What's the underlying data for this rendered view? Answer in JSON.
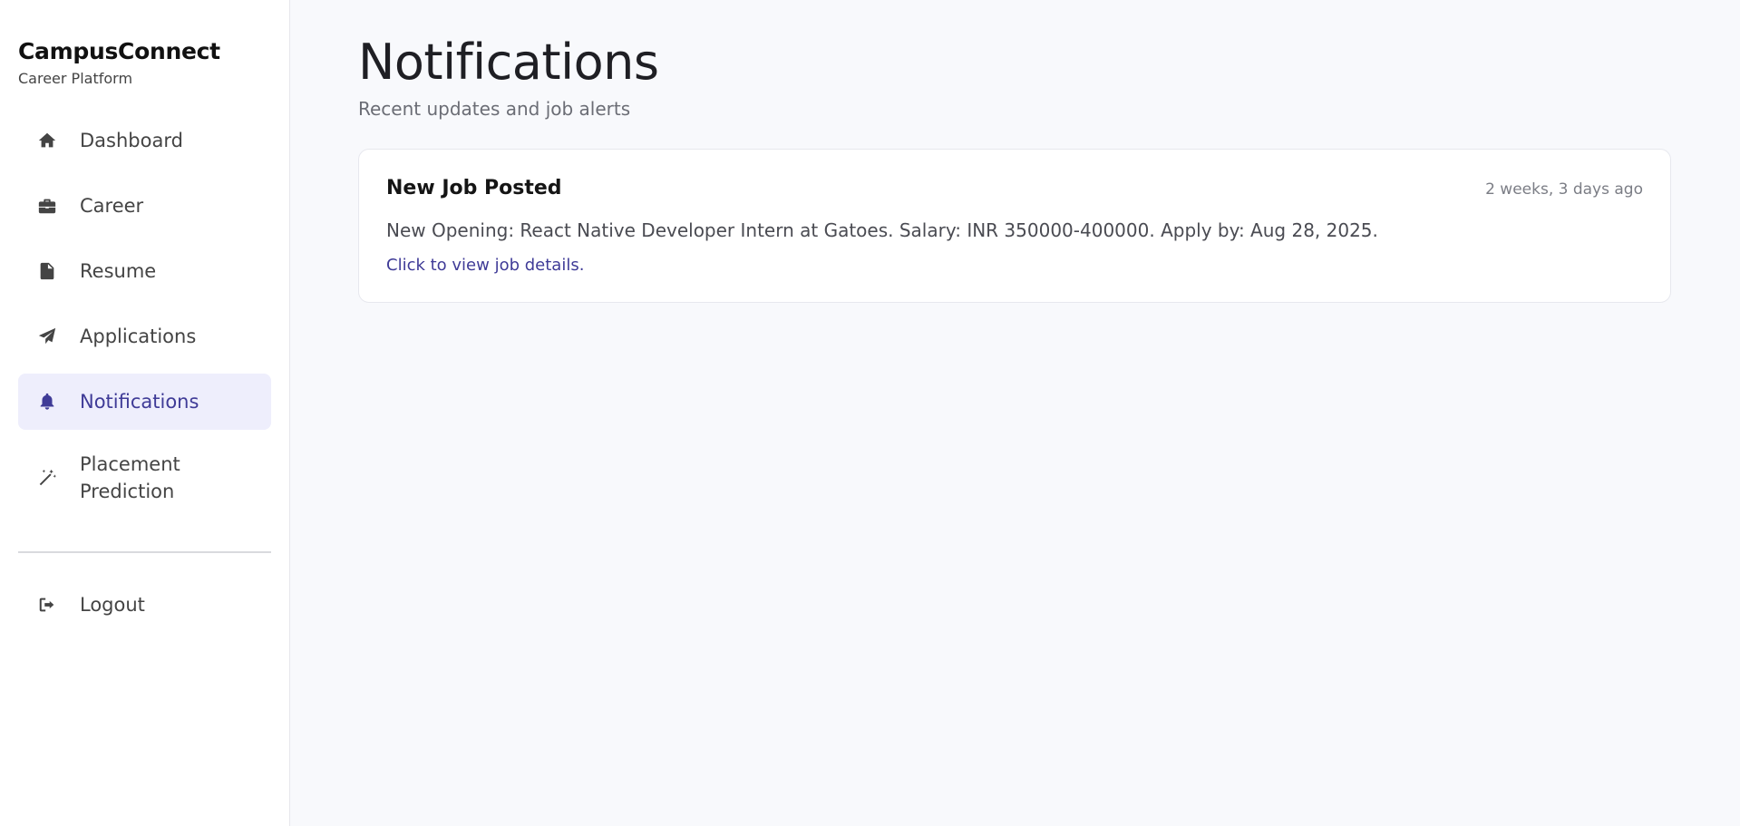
{
  "brand": {
    "title": "CampusConnect",
    "subtitle": "Career Platform"
  },
  "sidebar": {
    "items": [
      {
        "label": "Dashboard",
        "icon": "home-icon"
      },
      {
        "label": "Career",
        "icon": "briefcase-icon"
      },
      {
        "label": "Resume",
        "icon": "file-icon"
      },
      {
        "label": "Applications",
        "icon": "paper-plane-icon"
      },
      {
        "label": "Notifications",
        "icon": "bell-icon",
        "active": true
      },
      {
        "label": "Placement Prediction",
        "icon": "magic-wand-icon"
      }
    ],
    "logout": {
      "label": "Logout",
      "icon": "logout-icon"
    }
  },
  "main": {
    "title": "Notifications",
    "subtitle": "Recent updates and job alerts",
    "notifications": [
      {
        "title": "New Job Posted",
        "time": "2 weeks, 3 days ago",
        "message": "New Opening: React Native Developer Intern at Gatoes. Salary: INR 350000-400000. Apply by: Aug 28, 2025.",
        "link": "Click to view job details."
      }
    ]
  },
  "colors": {
    "accent": "#3f3b97",
    "active_bg": "#eeeefc",
    "page_bg": "#f8f9fc"
  }
}
